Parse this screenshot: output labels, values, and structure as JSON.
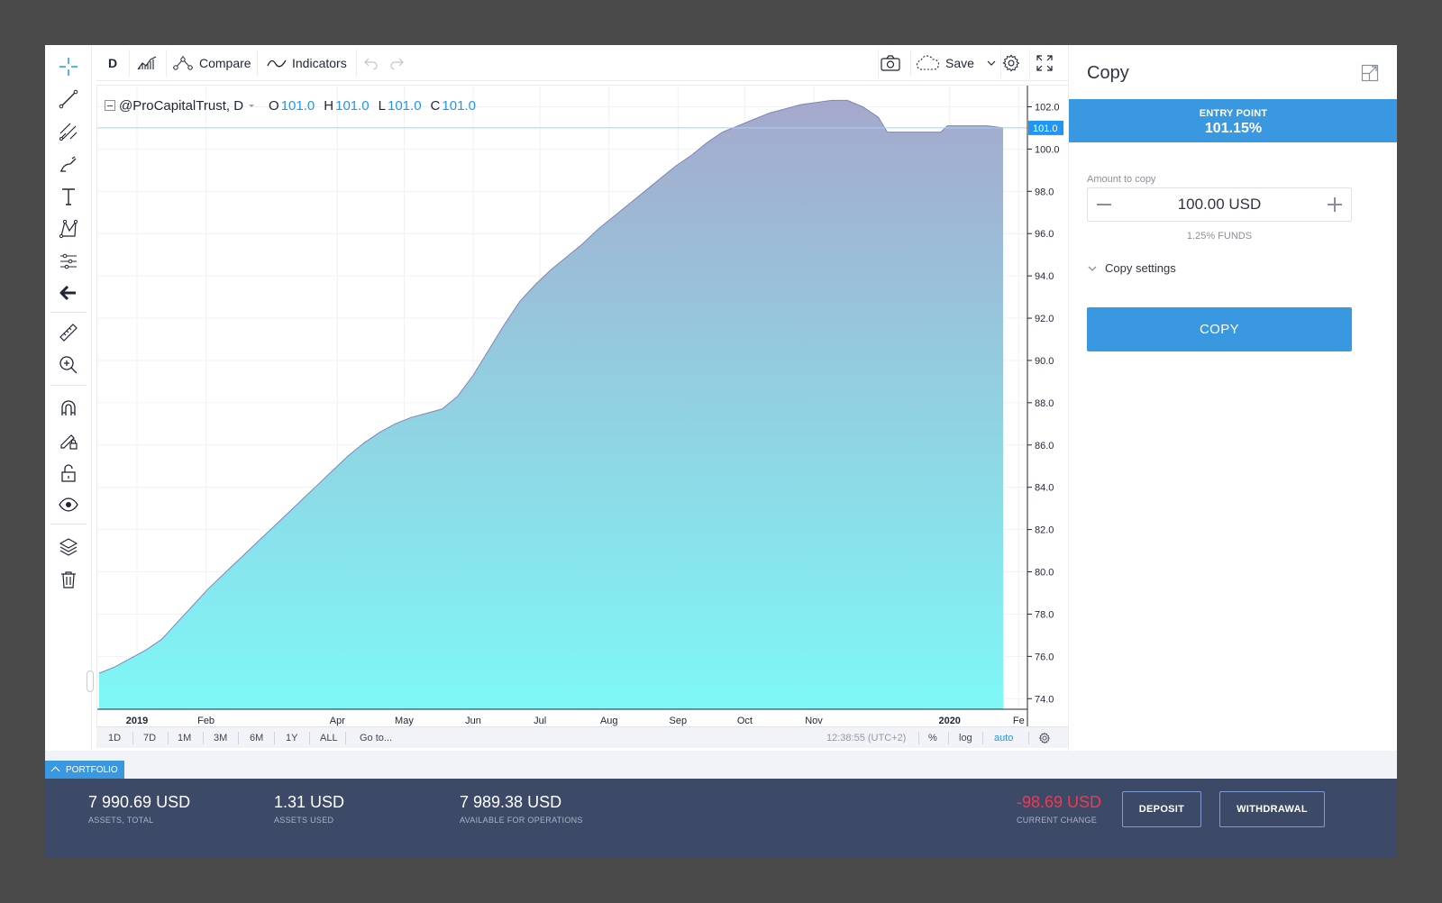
{
  "toolbar": {
    "interval": "D",
    "compare_label": "Compare",
    "indicators_label": "Indicators",
    "save_label": "Save"
  },
  "legend": {
    "symbol": "@ProCapitalTrust, D",
    "o_key": "O",
    "o_val": "101.0",
    "h_key": "H",
    "h_val": "101.0",
    "l_key": "L",
    "l_val": "101.0",
    "c_key": "C",
    "c_val": "101.0"
  },
  "chart_data": {
    "type": "area",
    "y_ticks": [
      "102.0",
      "100.0",
      "98.0",
      "96.0",
      "94.0",
      "92.0",
      "90.0",
      "88.0",
      "86.0",
      "84.0",
      "82.0",
      "80.0",
      "78.0",
      "76.0",
      "74.0"
    ],
    "ylim": [
      73.5,
      103.0
    ],
    "x_ticks": [
      "2019",
      "Feb",
      "Apr",
      "May",
      "Jun",
      "Jul",
      "Aug",
      "Sep",
      "Oct",
      "Nov",
      "2020",
      "Fe"
    ],
    "price_label": "101.0",
    "current_value": 101.0,
    "series": [
      {
        "dates": [
          "2018-12-15",
          "2018-12-22",
          "2018-12-29",
          "2019-01-05",
          "2019-01-12",
          "2019-01-19",
          "2019-01-26",
          "2019-02-02",
          "2019-02-09",
          "2019-02-16",
          "2019-02-23",
          "2019-03-02",
          "2019-03-09",
          "2019-03-16",
          "2019-03-23",
          "2019-03-30",
          "2019-04-06",
          "2019-04-13",
          "2019-04-20",
          "2019-04-27",
          "2019-05-04",
          "2019-05-11",
          "2019-05-18",
          "2019-05-25",
          "2019-06-01",
          "2019-06-08",
          "2019-06-15",
          "2019-06-22",
          "2019-06-29",
          "2019-07-06",
          "2019-07-13",
          "2019-07-20",
          "2019-07-27",
          "2019-08-03",
          "2019-08-10",
          "2019-08-17",
          "2019-08-24",
          "2019-08-31",
          "2019-09-07",
          "2019-09-14",
          "2019-09-21",
          "2019-09-28",
          "2019-10-05",
          "2019-10-12",
          "2019-10-19",
          "2019-10-26",
          "2019-11-02",
          "2019-11-09",
          "2019-11-16",
          "2019-11-23",
          "2019-11-30",
          "2019-12-04",
          "2019-12-07",
          "2019-12-14",
          "2019-12-21",
          "2019-12-28",
          "2019-12-31",
          "2020-01-04",
          "2020-01-11",
          "2020-01-18",
          "2020-01-25"
        ],
        "values": [
          75.2,
          75.5,
          75.9,
          76.3,
          76.8,
          77.6,
          78.4,
          79.2,
          79.9,
          80.6,
          81.3,
          82.0,
          82.7,
          83.4,
          84.1,
          84.8,
          85.5,
          86.1,
          86.6,
          87.0,
          87.3,
          87.5,
          87.7,
          88.3,
          89.3,
          90.5,
          91.7,
          92.8,
          93.6,
          94.3,
          94.9,
          95.5,
          96.2,
          96.8,
          97.4,
          98.0,
          98.6,
          99.2,
          99.7,
          100.3,
          100.8,
          101.1,
          101.4,
          101.7,
          101.9,
          102.1,
          102.2,
          102.3,
          102.3,
          102.0,
          101.5,
          100.8,
          100.8,
          100.8,
          100.8,
          100.8,
          101.1,
          101.1,
          101.1,
          101.1,
          101.0
        ]
      }
    ]
  },
  "bottom_bar": {
    "ranges": [
      "1D",
      "7D",
      "1M",
      "3M",
      "6M",
      "1Y",
      "ALL"
    ],
    "goto_label": "Go to...",
    "time": "12:38:55 (UTC+2)",
    "percent": "%",
    "log": "log",
    "auto": "auto"
  },
  "copy_panel": {
    "title": "Copy",
    "entry_label": "ENTRY POINT",
    "entry_value": "101.15%",
    "amount_label": "Amount to copy",
    "amount_value": "100.00 USD",
    "funds_note": "1.25% FUNDS",
    "settings_label": "Copy settings",
    "copy_button": "COPY"
  },
  "portfolio": {
    "tab_label": "PORTFOLIO",
    "assets_total_value": "7 990.69 USD",
    "assets_total_label": "ASSETS, TOTAL",
    "assets_used_value": "1.31 USD",
    "assets_used_label": "ASSETS USED",
    "available_value": "7 989.38 USD",
    "available_label": "AVAILABLE FOR OPERATIONS",
    "change_value": "-98.69 USD",
    "change_label": "CURRENT CHANGE",
    "deposit_label": "DEPOSIT",
    "withdrawal_label": "WITHDRAWAL"
  },
  "colors": {
    "accent": "#3a98e0",
    "negative": "#f0384f",
    "footer_bg": "#3c4a67",
    "area_top": "#a5a9cc",
    "area_bottom": "#7ef8f7"
  }
}
